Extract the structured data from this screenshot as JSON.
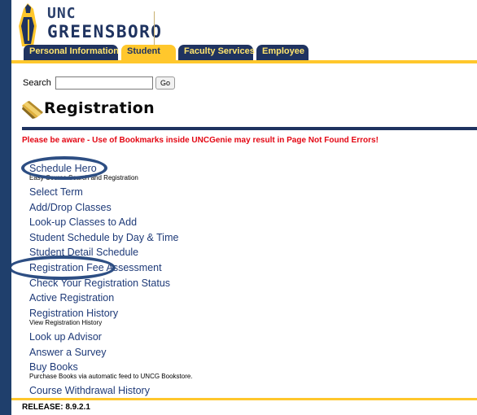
{
  "logo": {
    "line1": "UNC",
    "line2": "GREENSBORO"
  },
  "tabs": [
    {
      "label": "Personal Information",
      "active": false
    },
    {
      "label": "Student",
      "active": true
    },
    {
      "label": "Faculty Services",
      "active": false
    },
    {
      "label": "Employee",
      "active": false
    }
  ],
  "search": {
    "label": "Search",
    "value": "",
    "placeholder": "",
    "go_label": "Go"
  },
  "page": {
    "title": "Registration"
  },
  "warning": "Please be aware - Use of Bookmarks inside UNCGenie may result in Page Not Found Errors!",
  "menu": [
    {
      "label": "Schedule Hero",
      "description": "Easy Course Search and Registration"
    },
    {
      "label": "Select Term"
    },
    {
      "label": "Add/Drop Classes"
    },
    {
      "label": "Look-up Classes to Add"
    },
    {
      "label": "Student Schedule by Day & Time"
    },
    {
      "label": "Student Detail Schedule"
    },
    {
      "label": "Registration Fee Assessment"
    },
    {
      "label": "Check Your Registration Status"
    },
    {
      "label": "Active Registration"
    },
    {
      "label": "Registration History",
      "description": "View Registration History"
    },
    {
      "label": "Look up Advisor"
    },
    {
      "label": "Answer a Survey"
    },
    {
      "label": "Buy Books",
      "description": "Purchase Books via automatic feed to UNCG Bookstore."
    },
    {
      "label": "Course Withdrawal History"
    }
  ],
  "release": "RELEASE: 8.9.2.1",
  "colors": {
    "navy": "#1f3360",
    "gold": "#ffc72c",
    "link": "#1e3a78",
    "warning": "#e30613",
    "highlight_oval": "#2d4e83"
  }
}
